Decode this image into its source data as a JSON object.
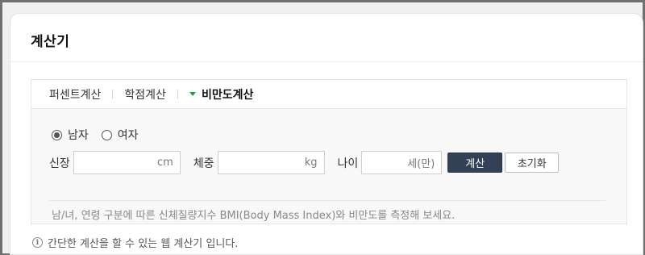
{
  "card": {
    "title": "계산기"
  },
  "tabs": [
    {
      "label": "퍼센트계산",
      "active": false
    },
    {
      "label": "학점계산",
      "active": false
    },
    {
      "label": "비만도계산",
      "active": true
    }
  ],
  "gender": {
    "options": [
      {
        "label": "남자",
        "checked": true
      },
      {
        "label": "여자",
        "checked": false
      }
    ]
  },
  "fields": {
    "height": {
      "label": "신장",
      "unit": "cm",
      "value": ""
    },
    "weight": {
      "label": "체중",
      "unit": "kg",
      "value": ""
    },
    "age": {
      "label": "나이",
      "unit": "세(만)",
      "value": ""
    }
  },
  "buttons": {
    "calculate": "계산",
    "reset": "초기화"
  },
  "help_text": "남/녀, 연령 구분에 따른 신체질량지수 BMI(Body Mass Index)와 비만도를 측정해 보세요.",
  "footnote": {
    "icon": "info-icon",
    "text": "간단한 계산을 할 수 있는 웹 계산기 입니다."
  },
  "colors": {
    "accent_triangle": "#2a9b3a",
    "primary_button": "#334055"
  }
}
